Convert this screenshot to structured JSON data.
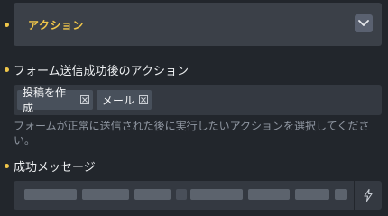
{
  "section": {
    "title": "アクション",
    "toggle_icon": "chevron-down-icon"
  },
  "actions_field": {
    "label": "フォーム送信成功後のアクション",
    "tags": [
      {
        "label": "投稿を作成",
        "remove_icon": "close-box-icon"
      },
      {
        "label": "メール",
        "remove_icon": "close-box-icon"
      }
    ],
    "help": "フォームが正常に送信された後に実行したいアクションを選択してください。"
  },
  "success_message_field": {
    "label": "成功メッセージ",
    "dynamic_tag_icon": "lightning-bolt-icon"
  },
  "colors": {
    "accent": "#f0c64a",
    "background": "#22262c",
    "panel": "#3b4048"
  }
}
